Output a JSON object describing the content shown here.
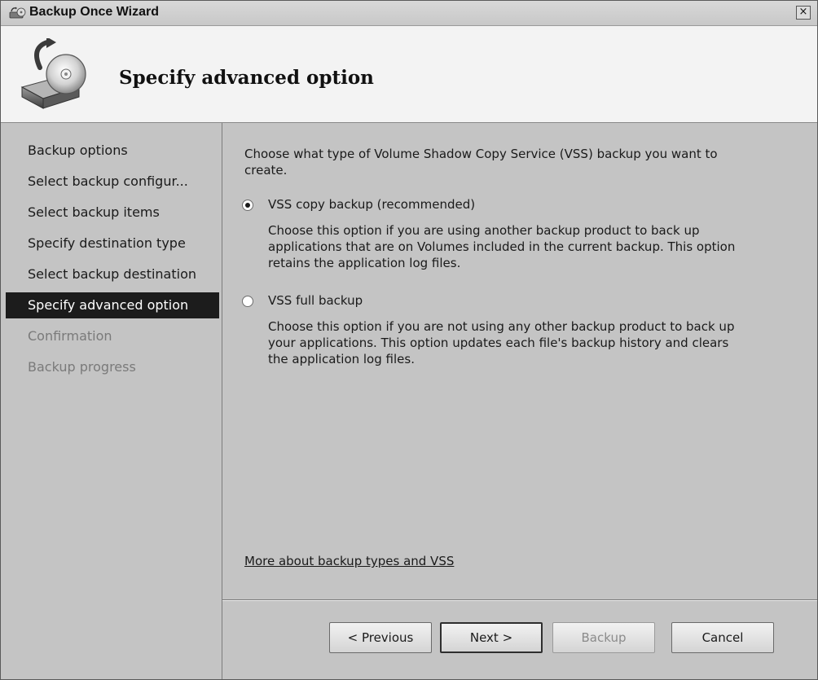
{
  "window": {
    "title": "Backup Once Wizard",
    "close_glyph": "×"
  },
  "header": {
    "title": "Specify advanced option",
    "icon": "backup-drive-icon"
  },
  "nav": {
    "items": [
      {
        "label": "Backup options",
        "state": "normal"
      },
      {
        "label": "Select backup configur...",
        "state": "normal"
      },
      {
        "label": "Select backup items",
        "state": "normal"
      },
      {
        "label": "Specify destination type",
        "state": "normal"
      },
      {
        "label": "Select backup destination",
        "state": "normal"
      },
      {
        "label": "Specify advanced option",
        "state": "active"
      },
      {
        "label": "Confirmation",
        "state": "disabled"
      },
      {
        "label": "Backup progress",
        "state": "disabled"
      }
    ]
  },
  "content": {
    "intro_line1": "Choose what type of Volume Shadow Copy Service (VSS) backup you want to",
    "intro_line2": "create.",
    "options": [
      {
        "label": "VSS copy backup (recommended)",
        "checked": true,
        "desc_lines": [
          "Choose this option if you are using another backup product to back up",
          "applications that are on Volumes included in the current backup. This option",
          "retains the application log files."
        ]
      },
      {
        "label": "VSS full backup",
        "checked": false,
        "desc_lines": [
          "Choose this option if you are not using any other backup product to back up",
          "your applications. This option updates each file's backup history and clears",
          "the application log files."
        ]
      }
    ],
    "link": "More about backup types and VSS"
  },
  "footer": {
    "previous": "< Previous",
    "next": "Next >",
    "backup": "Backup",
    "cancel": "Cancel"
  }
}
